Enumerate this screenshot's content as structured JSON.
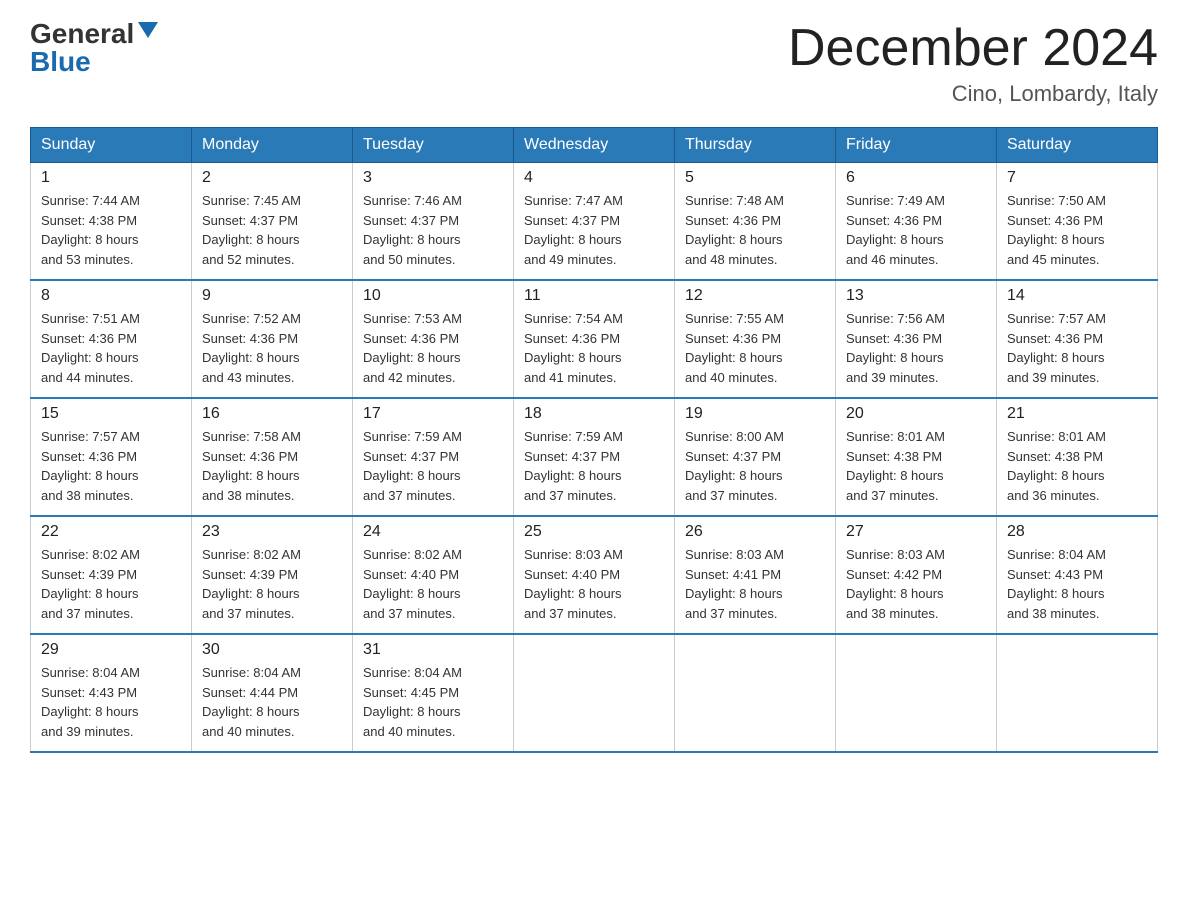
{
  "header": {
    "logo_general": "General",
    "logo_blue": "Blue",
    "month_title": "December 2024",
    "location": "Cino, Lombardy, Italy"
  },
  "days_of_week": [
    "Sunday",
    "Monday",
    "Tuesday",
    "Wednesday",
    "Thursday",
    "Friday",
    "Saturday"
  ],
  "weeks": [
    [
      {
        "day": "1",
        "sunrise": "7:44 AM",
        "sunset": "4:38 PM",
        "daylight": "8 hours and 53 minutes."
      },
      {
        "day": "2",
        "sunrise": "7:45 AM",
        "sunset": "4:37 PM",
        "daylight": "8 hours and 52 minutes."
      },
      {
        "day": "3",
        "sunrise": "7:46 AM",
        "sunset": "4:37 PM",
        "daylight": "8 hours and 50 minutes."
      },
      {
        "day": "4",
        "sunrise": "7:47 AM",
        "sunset": "4:37 PM",
        "daylight": "8 hours and 49 minutes."
      },
      {
        "day": "5",
        "sunrise": "7:48 AM",
        "sunset": "4:36 PM",
        "daylight": "8 hours and 48 minutes."
      },
      {
        "day": "6",
        "sunrise": "7:49 AM",
        "sunset": "4:36 PM",
        "daylight": "8 hours and 46 minutes."
      },
      {
        "day": "7",
        "sunrise": "7:50 AM",
        "sunset": "4:36 PM",
        "daylight": "8 hours and 45 minutes."
      }
    ],
    [
      {
        "day": "8",
        "sunrise": "7:51 AM",
        "sunset": "4:36 PM",
        "daylight": "8 hours and 44 minutes."
      },
      {
        "day": "9",
        "sunrise": "7:52 AM",
        "sunset": "4:36 PM",
        "daylight": "8 hours and 43 minutes."
      },
      {
        "day": "10",
        "sunrise": "7:53 AM",
        "sunset": "4:36 PM",
        "daylight": "8 hours and 42 minutes."
      },
      {
        "day": "11",
        "sunrise": "7:54 AM",
        "sunset": "4:36 PM",
        "daylight": "8 hours and 41 minutes."
      },
      {
        "day": "12",
        "sunrise": "7:55 AM",
        "sunset": "4:36 PM",
        "daylight": "8 hours and 40 minutes."
      },
      {
        "day": "13",
        "sunrise": "7:56 AM",
        "sunset": "4:36 PM",
        "daylight": "8 hours and 39 minutes."
      },
      {
        "day": "14",
        "sunrise": "7:57 AM",
        "sunset": "4:36 PM",
        "daylight": "8 hours and 39 minutes."
      }
    ],
    [
      {
        "day": "15",
        "sunrise": "7:57 AM",
        "sunset": "4:36 PM",
        "daylight": "8 hours and 38 minutes."
      },
      {
        "day": "16",
        "sunrise": "7:58 AM",
        "sunset": "4:36 PM",
        "daylight": "8 hours and 38 minutes."
      },
      {
        "day": "17",
        "sunrise": "7:59 AM",
        "sunset": "4:37 PM",
        "daylight": "8 hours and 37 minutes."
      },
      {
        "day": "18",
        "sunrise": "7:59 AM",
        "sunset": "4:37 PM",
        "daylight": "8 hours and 37 minutes."
      },
      {
        "day": "19",
        "sunrise": "8:00 AM",
        "sunset": "4:37 PM",
        "daylight": "8 hours and 37 minutes."
      },
      {
        "day": "20",
        "sunrise": "8:01 AM",
        "sunset": "4:38 PM",
        "daylight": "8 hours and 37 minutes."
      },
      {
        "day": "21",
        "sunrise": "8:01 AM",
        "sunset": "4:38 PM",
        "daylight": "8 hours and 36 minutes."
      }
    ],
    [
      {
        "day": "22",
        "sunrise": "8:02 AM",
        "sunset": "4:39 PM",
        "daylight": "8 hours and 37 minutes."
      },
      {
        "day": "23",
        "sunrise": "8:02 AM",
        "sunset": "4:39 PM",
        "daylight": "8 hours and 37 minutes."
      },
      {
        "day": "24",
        "sunrise": "8:02 AM",
        "sunset": "4:40 PM",
        "daylight": "8 hours and 37 minutes."
      },
      {
        "day": "25",
        "sunrise": "8:03 AM",
        "sunset": "4:40 PM",
        "daylight": "8 hours and 37 minutes."
      },
      {
        "day": "26",
        "sunrise": "8:03 AM",
        "sunset": "4:41 PM",
        "daylight": "8 hours and 37 minutes."
      },
      {
        "day": "27",
        "sunrise": "8:03 AM",
        "sunset": "4:42 PM",
        "daylight": "8 hours and 38 minutes."
      },
      {
        "day": "28",
        "sunrise": "8:04 AM",
        "sunset": "4:43 PM",
        "daylight": "8 hours and 38 minutes."
      }
    ],
    [
      {
        "day": "29",
        "sunrise": "8:04 AM",
        "sunset": "4:43 PM",
        "daylight": "8 hours and 39 minutes."
      },
      {
        "day": "30",
        "sunrise": "8:04 AM",
        "sunset": "4:44 PM",
        "daylight": "8 hours and 40 minutes."
      },
      {
        "day": "31",
        "sunrise": "8:04 AM",
        "sunset": "4:45 PM",
        "daylight": "8 hours and 40 minutes."
      },
      null,
      null,
      null,
      null
    ]
  ],
  "labels": {
    "sunrise": "Sunrise:",
    "sunset": "Sunset:",
    "daylight": "Daylight:"
  }
}
